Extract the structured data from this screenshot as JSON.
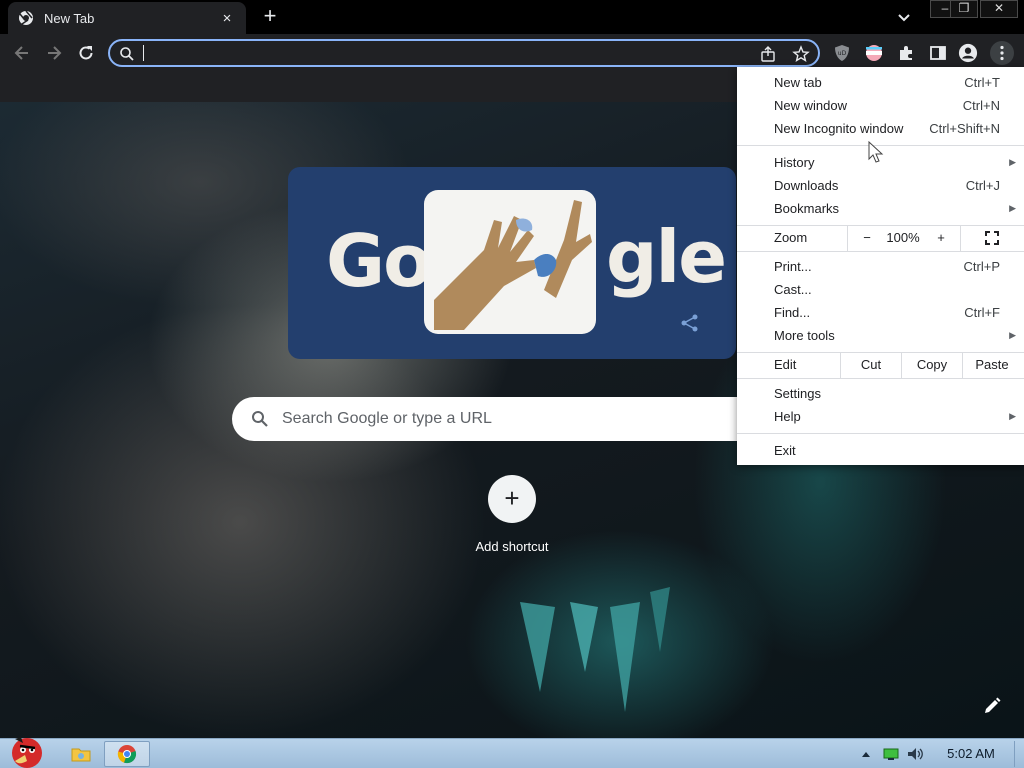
{
  "browser": {
    "tab": {
      "title": "New Tab",
      "close": "×"
    },
    "new_tab_symbol": "+",
    "window_controls": {
      "minimize": "‒",
      "restore": "❐",
      "close": "✕"
    },
    "omnibox": {
      "value": "",
      "placeholder": ""
    }
  },
  "newtab_page": {
    "doodle": {
      "left_text": "Go",
      "right_text": "gle"
    },
    "search": {
      "placeholder": "Search Google or type a URL"
    },
    "shortcut": {
      "symbol": "+",
      "label": "Add shortcut"
    }
  },
  "menu": {
    "new_tab": {
      "label": "New tab",
      "shortcut": "Ctrl+T"
    },
    "new_window": {
      "label": "New window",
      "shortcut": "Ctrl+N"
    },
    "new_incognito": {
      "label": "New Incognito window",
      "shortcut": "Ctrl+Shift+N"
    },
    "history": {
      "label": "History"
    },
    "downloads": {
      "label": "Downloads",
      "shortcut": "Ctrl+J"
    },
    "bookmarks": {
      "label": "Bookmarks"
    },
    "zoom": {
      "label": "Zoom",
      "minus": "−",
      "value": "100%",
      "plus": "+"
    },
    "print": {
      "label": "Print...",
      "shortcut": "Ctrl+P"
    },
    "cast": {
      "label": "Cast..."
    },
    "find": {
      "label": "Find...",
      "shortcut": "Ctrl+F"
    },
    "more_tools": {
      "label": "More tools"
    },
    "edit": {
      "label": "Edit",
      "cut": "Cut",
      "copy": "Copy",
      "paste": "Paste"
    },
    "settings": {
      "label": "Settings"
    },
    "help": {
      "label": "Help"
    },
    "exit": {
      "label": "Exit"
    },
    "submenu_arrow": "▶"
  },
  "taskbar": {
    "clock": "5:02 AM"
  },
  "colors": {
    "chrome_dark": "#202124",
    "omnibox_focus": "#8ab4f8",
    "doodle_bg": "#233f6e",
    "menu_bg": "#ffffff",
    "taskbar": "#b8d2ea"
  },
  "icons": {
    "toolbar": [
      "back-arrow-icon",
      "forward-arrow-icon",
      "reload-icon",
      "share-icon",
      "bookmark-star-icon",
      "ublock-icon",
      "extension-circle-icon",
      "puzzle-icon",
      "side-panel-icon",
      "profile-icon",
      "kebab-menu-icon"
    ],
    "taskbar": [
      "angry-bird-start-icon",
      "explorer-folder-icon",
      "chrome-icon",
      "show-hidden-icons",
      "network-icon",
      "volume-icon"
    ]
  }
}
